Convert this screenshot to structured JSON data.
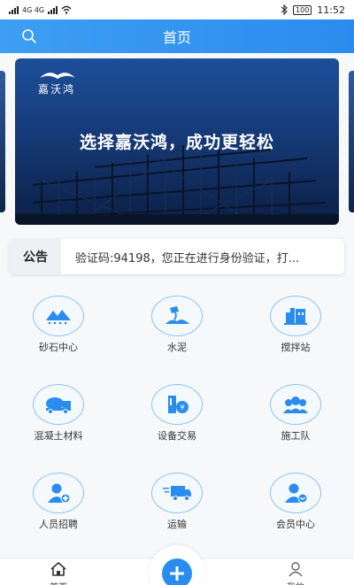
{
  "status_bar": {
    "left_text": "4G 4G",
    "time": "11:52",
    "battery": "100"
  },
  "header": {
    "title": "首页"
  },
  "banner": {
    "logo_text": "嘉沃鸿",
    "slogan": "选择嘉沃鸿，成功更轻松"
  },
  "notice": {
    "tag": "公告",
    "text": "验证码:94198，您正在进行身份验证，打..."
  },
  "categories": [
    {
      "label": "砂石中心",
      "icon": "sand-pile-icon"
    },
    {
      "label": "水泥",
      "icon": "cement-pour-icon"
    },
    {
      "label": "搅拌站",
      "icon": "mixing-station-icon"
    },
    {
      "label": "混凝土材料",
      "icon": "mixer-truck-icon"
    },
    {
      "label": "设备交易",
      "icon": "equipment-icon"
    },
    {
      "label": "施工队",
      "icon": "construction-team-icon"
    },
    {
      "label": "人员招聘",
      "icon": "recruit-user-icon"
    },
    {
      "label": "运输",
      "icon": "truck-icon"
    },
    {
      "label": "会员中心",
      "icon": "member-user-icon"
    }
  ],
  "tabbar": {
    "home_label": "首页",
    "mine_label": "我的"
  },
  "colors": {
    "primary": "#2b8cef",
    "icon_ring": "#8cc3f2"
  }
}
